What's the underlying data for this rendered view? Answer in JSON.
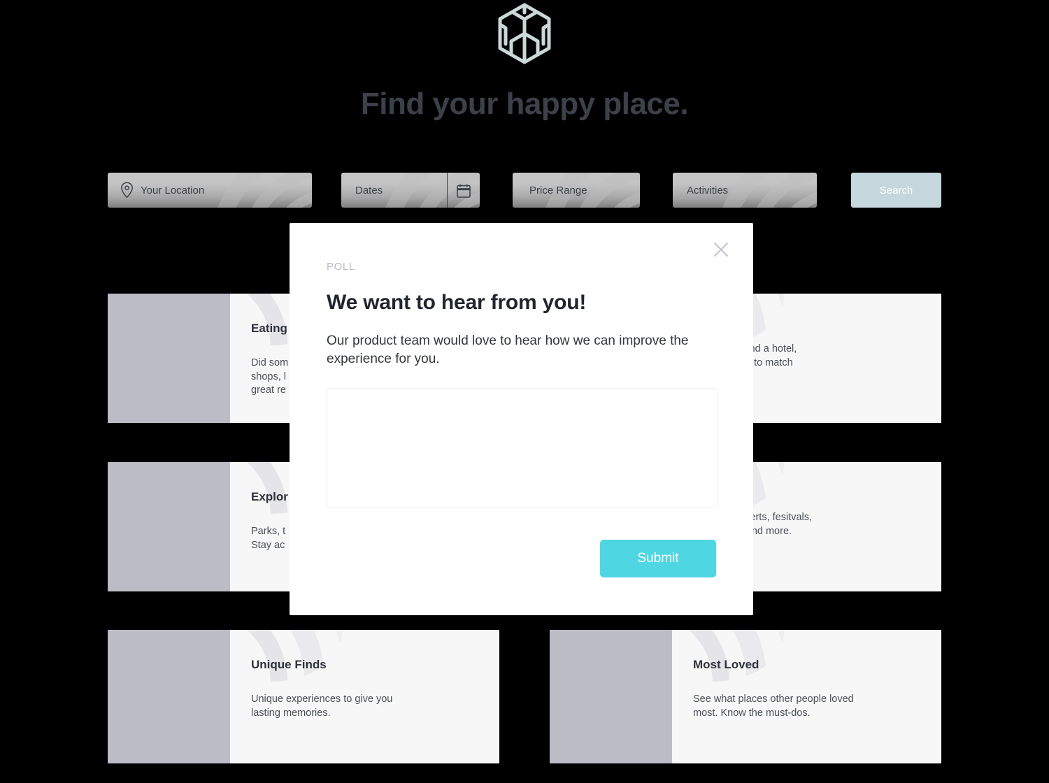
{
  "brand": {
    "logo_icon": "cube-logo-icon",
    "logo_color": "#cad8d6"
  },
  "header": {
    "headline": "Find your happy place."
  },
  "search": {
    "location": {
      "icon": "location-pin-icon",
      "placeholder": "Your Location",
      "value": ""
    },
    "dates": {
      "icon": "calendar-icon",
      "placeholder": "Dates",
      "value": ""
    },
    "price": {
      "placeholder": "Price Range",
      "value": ""
    },
    "activities": {
      "placeholder": "Activities",
      "value": ""
    },
    "submit_label": "Search",
    "submit_color": "#c5d6dd"
  },
  "cards": [
    {
      "title": "Eating",
      "text": "Did som\nshops, l\ngreat re",
      "occluded": true
    },
    {
      "title": "",
      "text": "ay awhile. Find a hotel,\nen tiny home to match",
      "occluded": true
    },
    {
      "title": "Explor",
      "text": " Parks, t\n Stay ac",
      "occluded": true
    },
    {
      "title": "",
      "text": "vents – concerts, fesitvals,\nformances, and more.",
      "occluded": true
    },
    {
      "title": "Unique Finds",
      "text": "Unique experiences to give you\nlasting memories.",
      "occluded": false
    },
    {
      "title": "Most Loved",
      "text": "See what places other people loved\nmost. Know the must-dos.",
      "occluded": false
    }
  ],
  "modal": {
    "close_icon": "close-x-icon",
    "eyebrow": "POLL",
    "title": "We want to hear from you!",
    "description": "Our product team would love to hear how we can improve the experience for you.",
    "textarea_value": "",
    "textarea_placeholder": "",
    "submit_label": "Submit",
    "submit_color": "#4fd6e3"
  }
}
